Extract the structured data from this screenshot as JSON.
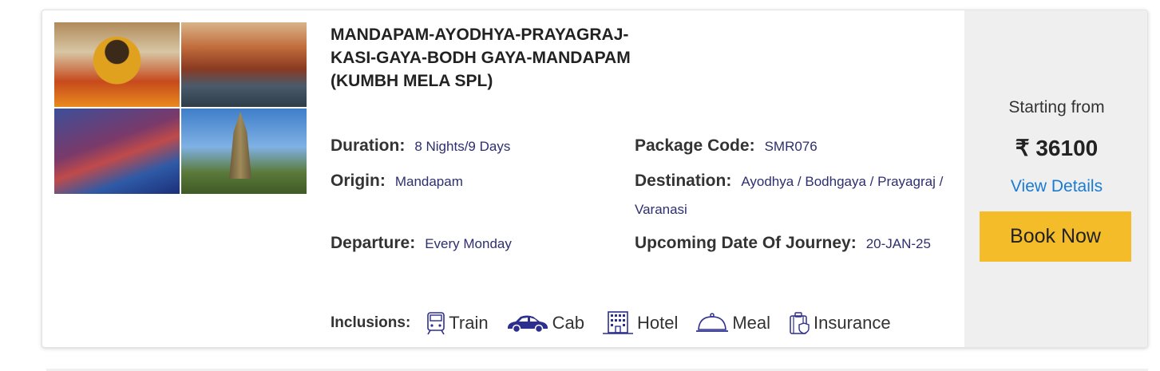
{
  "package": {
    "title": "MANDAPAM-AYODHYA-PRAYAGRAJ-KASI-GAYA-BODH GAYA-MANDAPAM (KUMBH MELA SPL)",
    "duration_label": "Duration:",
    "duration": "8 Nights/9 Days",
    "code_label": "Package Code:",
    "code": "SMR076",
    "origin_label": "Origin:",
    "origin": "Mandapam",
    "destination_label": "Destination:",
    "destination": "Ayodhya / Bodhgaya / Prayagraj / Varanasi",
    "departure_label": "Departure:",
    "departure": "Every Monday",
    "journey_label": "Upcoming Date Of Journey:",
    "journey": "20-JAN-25"
  },
  "inclusions": {
    "label": "Inclusions:",
    "items": [
      {
        "icon": "train-icon",
        "label": "Train"
      },
      {
        "icon": "cab-icon",
        "label": "Cab"
      },
      {
        "icon": "hotel-icon",
        "label": "Hotel"
      },
      {
        "icon": "meal-icon",
        "label": "Meal"
      },
      {
        "icon": "insurance-icon",
        "label": "Insurance"
      }
    ]
  },
  "pricing": {
    "starting_label": "Starting from",
    "price": "₹ 36100",
    "view_details": "View Details",
    "book_now": "Book Now"
  },
  "colors": {
    "accent_button": "#f5bc2a",
    "link": "#1a7bd1",
    "value_text": "#2d2f6e",
    "icon": "#2d2f8e"
  }
}
